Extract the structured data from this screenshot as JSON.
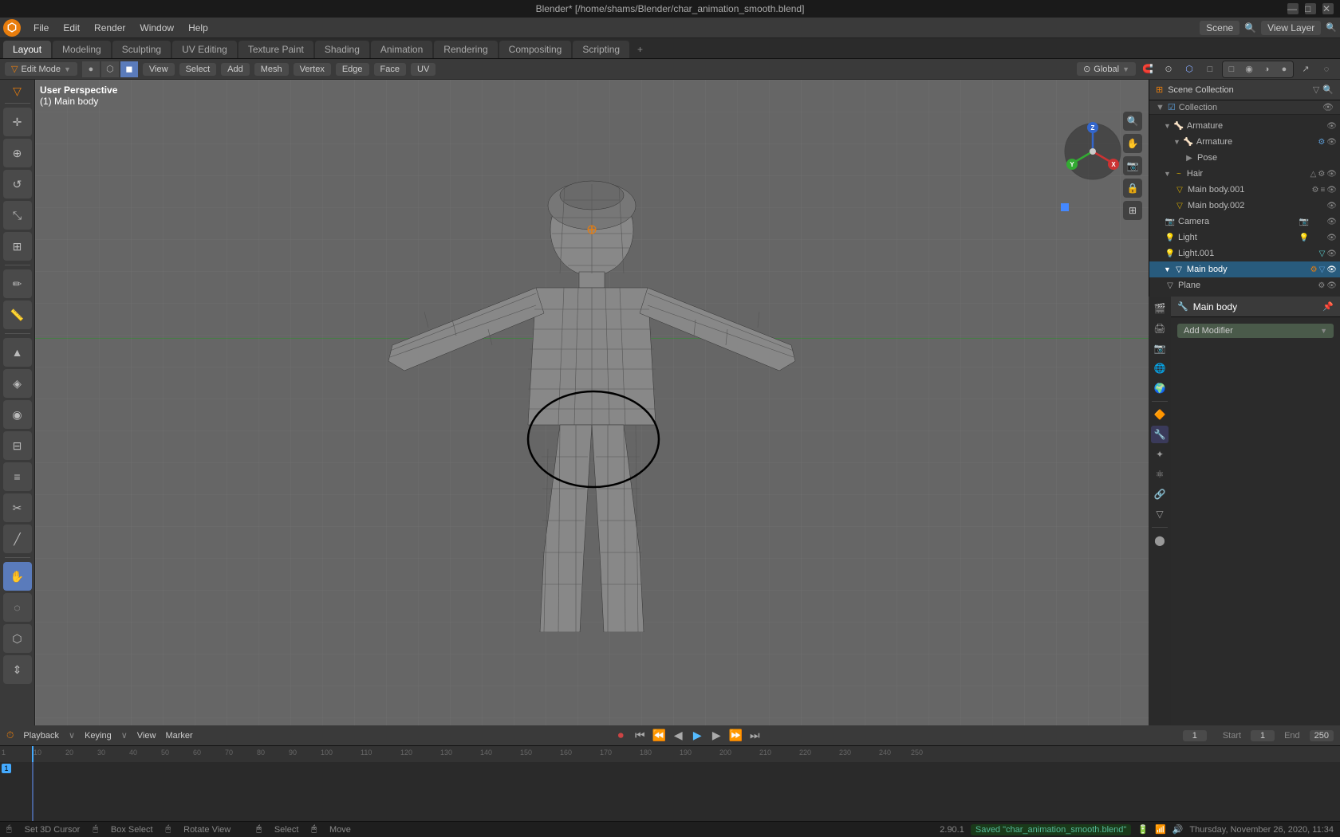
{
  "window": {
    "title": "Blender* [/home/shams/Blender/char_animation_smooth.blend]"
  },
  "menu_bar": {
    "blender_icon": "🔶",
    "items": [
      "File",
      "Edit",
      "Render",
      "Window",
      "Help"
    ]
  },
  "workspace_tabs": {
    "tabs": [
      "Layout",
      "Modeling",
      "Sculpting",
      "UV Editing",
      "Texture Paint",
      "Shading",
      "Animation",
      "Rendering",
      "Compositing",
      "Scripting"
    ],
    "active": "Layout",
    "plus_label": "+",
    "view_layer_label": "View Layer",
    "scene_label": "Scene"
  },
  "viewport_header": {
    "mode_label": "Edit Mode",
    "view_label": "View",
    "select_label": "Select",
    "add_label": "Add",
    "mesh_label": "Mesh",
    "vertex_label": "Vertex",
    "edge_label": "Edge",
    "face_label": "Face",
    "uv_label": "UV",
    "transform_label": "Global",
    "proportional_icon": "⊙"
  },
  "viewport": {
    "info_line1": "User Perspective",
    "info_line2": "(1) Main body",
    "version": "2.90.1"
  },
  "outliner": {
    "title": "Scene Collection",
    "items": [
      {
        "name": "Collection",
        "level": 1,
        "icon": "📁",
        "color": "col-white",
        "visible": true,
        "expanded": true
      },
      {
        "name": "Armature",
        "level": 2,
        "icon": "🦴",
        "color": "col-blue",
        "visible": true
      },
      {
        "name": "Armature",
        "level": 3,
        "icon": "🦴",
        "color": "col-blue",
        "visible": true
      },
      {
        "name": "Pose",
        "level": 4,
        "icon": "▶",
        "color": "col-blue",
        "visible": false
      },
      {
        "name": "Hair",
        "level": 2,
        "icon": "~",
        "color": "col-yellow",
        "visible": true
      },
      {
        "name": "Main body.001",
        "level": 3,
        "icon": "▽",
        "color": "col-yellow",
        "visible": true
      },
      {
        "name": "Main body.002",
        "level": 3,
        "icon": "▽",
        "color": "col-yellow",
        "visible": true
      },
      {
        "name": "Camera",
        "level": 2,
        "icon": "📷",
        "color": "col-white",
        "visible": true
      },
      {
        "name": "Light",
        "level": 2,
        "icon": "💡",
        "color": "col-yellow",
        "visible": true
      },
      {
        "name": "Light.001",
        "level": 2,
        "icon": "💡",
        "color": "col-cyan",
        "visible": true
      },
      {
        "name": "Main body",
        "level": 2,
        "icon": "▽",
        "color": "col-white",
        "visible": true,
        "selected": true
      },
      {
        "name": "Plane",
        "level": 2,
        "icon": "▽",
        "color": "col-white",
        "visible": true
      }
    ]
  },
  "properties": {
    "object_name": "Main body",
    "modifier_label": "Add Modifier",
    "icons": [
      "🎬",
      "🔧",
      "⚙",
      "🔑",
      "👁",
      "🎯",
      "🌊",
      "⬛",
      "🔴",
      "🟤",
      "🔵",
      "🟢"
    ]
  },
  "timeline": {
    "playback_label": "Playback",
    "keying_label": "Keying",
    "view_label": "View",
    "marker_label": "Marker",
    "current_frame": "1",
    "start_label": "Start",
    "start_frame": "1",
    "end_label": "End",
    "end_frame": "250",
    "frame_numbers": [
      "1",
      "10",
      "20",
      "30",
      "40",
      "50",
      "60",
      "70",
      "80",
      "90",
      "100",
      "110",
      "120",
      "130",
      "140",
      "150",
      "160",
      "170",
      "180",
      "190",
      "200",
      "210",
      "220",
      "230",
      "240",
      "250"
    ]
  },
  "status_bar": {
    "key1": "Set 3D Cursor",
    "key2": "Box Select",
    "key3": "Rotate View",
    "select_label": "Select",
    "move_label": "Move",
    "version": "2.90.1",
    "saved_message": "Saved \"char_animation_smooth.blend\"",
    "datetime": "Thursday, November 26, 2020, 11:34"
  },
  "tools": {
    "left_tools": [
      {
        "name": "cursor",
        "icon": "✛",
        "active": false
      },
      {
        "name": "move",
        "icon": "⊕",
        "active": false
      },
      {
        "name": "rotate",
        "icon": "↺",
        "active": false
      },
      {
        "name": "scale",
        "icon": "⤡",
        "active": false
      },
      {
        "name": "transform",
        "icon": "⊞",
        "active": false
      },
      {
        "name": "annotate",
        "icon": "✏",
        "active": false
      },
      {
        "name": "measure",
        "icon": "📏",
        "active": false
      },
      {
        "name": "sep1",
        "type": "separator"
      },
      {
        "name": "extrude",
        "icon": "▲",
        "active": false
      },
      {
        "name": "inset",
        "icon": "◈",
        "active": false
      },
      {
        "name": "bevel",
        "icon": "◉",
        "active": false
      },
      {
        "name": "loop-cut",
        "icon": "⊟",
        "active": false
      },
      {
        "name": "offset-loop",
        "icon": "≡",
        "active": false
      },
      {
        "name": "sep2",
        "type": "separator"
      },
      {
        "name": "knife",
        "icon": "✂",
        "active": false
      },
      {
        "name": "bisect",
        "icon": "╱",
        "active": false
      },
      {
        "name": "sep3",
        "type": "separator"
      },
      {
        "name": "grab",
        "icon": "👋",
        "active": true
      },
      {
        "name": "smooth",
        "icon": "◌",
        "active": false
      },
      {
        "name": "relax",
        "icon": "⬡",
        "active": false
      }
    ]
  }
}
